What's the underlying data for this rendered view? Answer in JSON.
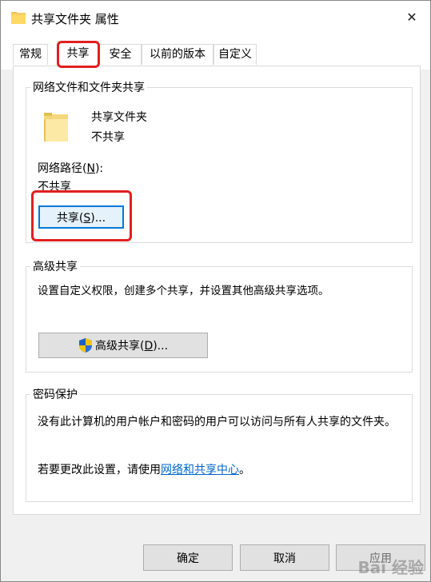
{
  "window": {
    "title": "共享文件夹 属性",
    "close_glyph": "✕"
  },
  "tabs": [
    {
      "label": "常规"
    },
    {
      "label": "共享"
    },
    {
      "label": "安全"
    },
    {
      "label": "以前的版本"
    },
    {
      "label": "自定义"
    }
  ],
  "network_sharing": {
    "legend": "网络文件和文件夹共享",
    "folder_name": "共享文件夹",
    "folder_status": "不共享",
    "network_path_label_pre": "网络路径(",
    "network_path_label_key": "N",
    "network_path_label_post": "):",
    "network_path_value": "不共享",
    "share_button_pre": "共享(",
    "share_button_key": "S",
    "share_button_post": ")..."
  },
  "advanced_sharing": {
    "legend": "高级共享",
    "description": "设置自定义权限，创建多个共享，并设置其他高级共享选项。",
    "button_pre": "高级共享(",
    "button_key": "D",
    "button_post": ")..."
  },
  "password_protection": {
    "legend": "密码保护",
    "description": "没有此计算机的用户帐户和密码的用户可以访问与所有人共享的文件夹。",
    "change_prefix": "若要更改此设置，请使用",
    "change_link": "网络和共享中心",
    "change_suffix": "。"
  },
  "footer": {
    "ok_label": "确定",
    "cancel_label": "取消",
    "apply_label": "应用"
  },
  "watermark": "Bai 经验",
  "colors": {
    "highlight_red": "#e02020",
    "focus_blue": "#0078d7",
    "link_blue": "#0066cc"
  },
  "icons": {
    "title_icon": "folder-icon",
    "large_icon": "folder-icon",
    "shield": "uac-shield-icon",
    "close": "close-icon"
  }
}
